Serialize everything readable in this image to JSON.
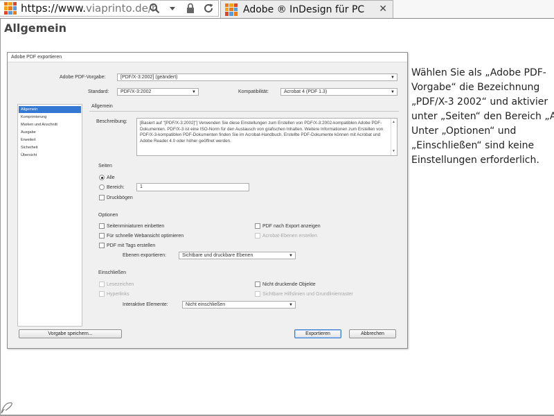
{
  "browser": {
    "url_prefix": "https://www.",
    "url_domain": "viaprinto.de/h",
    "tab_title": "Adobe ® InDesign für PC",
    "tab_close": "✕",
    "favicon_colors": [
      "#e87b1c",
      "#f5a31a",
      "#d9482b",
      "#f5a31a",
      "#e87b1c",
      "#5c9ad6",
      "#d9482b",
      "#5c9ad6",
      "#e87b1c"
    ]
  },
  "page": {
    "heading": "Allgemein",
    "side_text": [
      "Wählen Sie als „Adobe PDF-",
      "Vorgabe“ die Bezeichnung",
      "„PDF/X-3 2002“ und aktivier",
      "unter „Seiten“ den Bereich „A",
      "Unter „Optionen“ und",
      "„Einschließen“ sind keine",
      "Einstellungen erforderlich."
    ]
  },
  "dialog": {
    "title": "Adobe PDF exportieren",
    "preset_label": "Adobe PDF-Vorgabe:",
    "preset_value": "[PDF/X-3:2002] (geändert)",
    "standard_label": "Standard:",
    "standard_value": "PDF/X-3:2002",
    "compat_label": "Kompatibilität:",
    "compat_value": "Acrobat 4 (PDF 1.3)",
    "sidebar": [
      "Allgemein",
      "Komprimierung",
      "Marken und Anschnitt",
      "Ausgabe",
      "Erweitert",
      "Sicherheit",
      "Übersicht"
    ],
    "panel_title": "Allgemein",
    "desc_label": "Beschreibung:",
    "desc_text": "[Basiert auf \"[PDF/X-3:2002]\"] Verwenden Sie diese Einstellungen zum Erstellen von PDF/X-3:2002-kompatiblen Adobe PDF-Dokumenten. PDF/X-3 ist eine ISO-Norm für den Austausch von grafischen Inhalten. Weitere Informationen zum Erstellen von PDF/X-3-kompatiblen PDF-Dokumenten finden Sie im Acrobat-Handbuch. Erstellte PDF-Dokumente können mit Acrobat und Adobe Reader 4.0 oder höher geöffnet werden.",
    "pages": {
      "title": "Seiten",
      "all": "Alle",
      "range": "Bereich:",
      "range_value": "1",
      "spreads": "Druckbögen"
    },
    "options": {
      "title": "Optionen",
      "thumbnails": "Seitenminiaturen einbetten",
      "fastweb": "Für schnelle Webansicht optimieren",
      "tagged": "PDF mit Tags erstellen",
      "view_after": "PDF nach Export anzeigen",
      "acro_layers": "Acrobat-Ebenen erstellen",
      "export_layers_label": "Ebenen exportieren:",
      "export_layers_value": "Sichtbare und druckbare Ebenen"
    },
    "include": {
      "title": "Einschließen",
      "bookmarks": "Lesezeichen",
      "hyperlinks": "Hyperlinks",
      "nonprinting": "Nicht druckende Objekte",
      "guides": "Sichtbare Hilfslinien und Grundlinienraster",
      "interactive_label": "Interaktive Elemente:",
      "interactive_value": "Nicht einschließen"
    },
    "buttons": {
      "save_preset": "Vorgabe speichern...",
      "export": "Exportieren",
      "cancel": "Abbrechen"
    }
  }
}
